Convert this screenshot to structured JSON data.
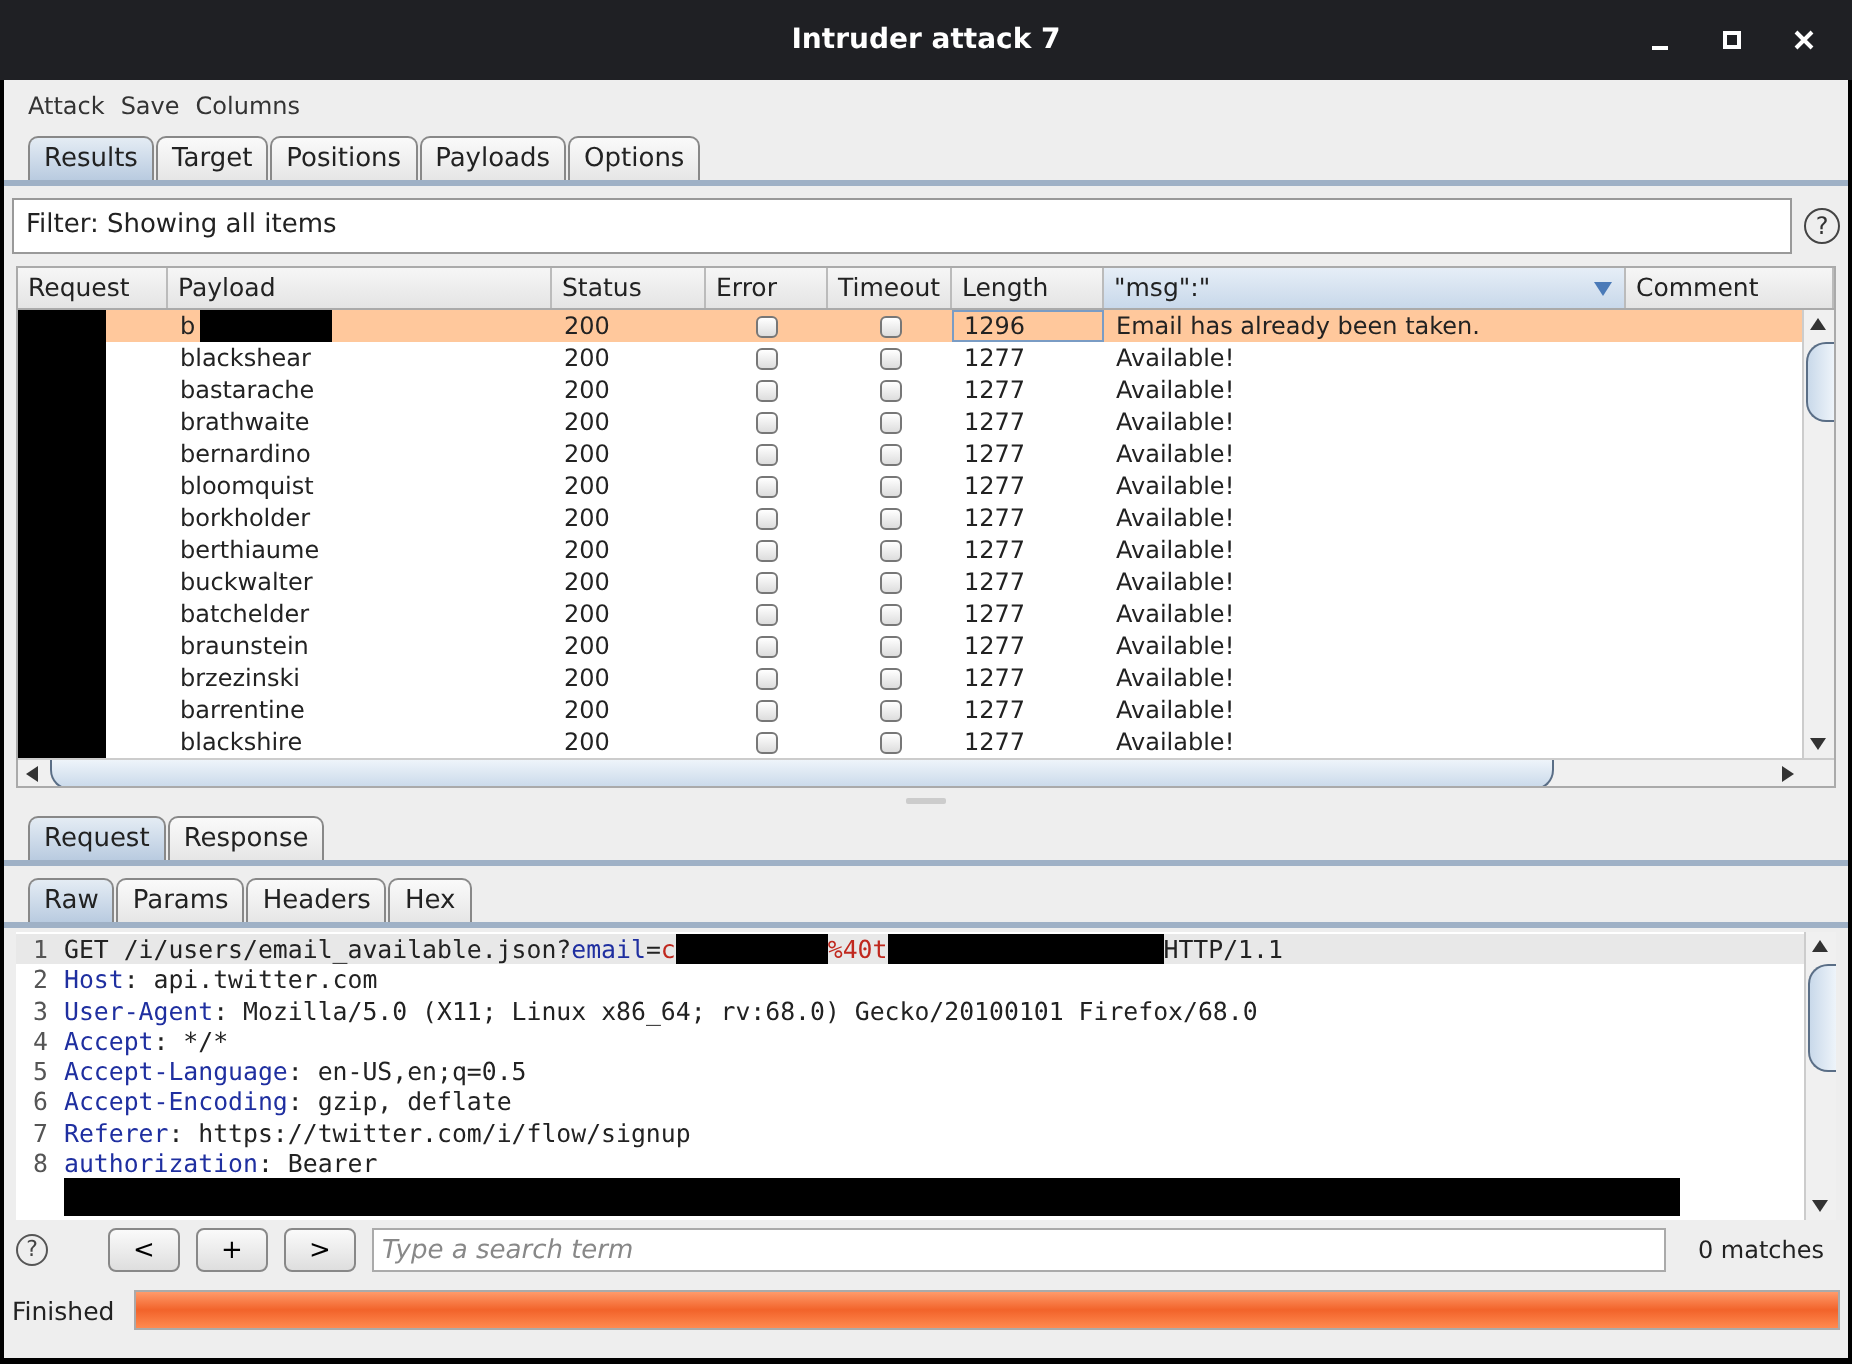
{
  "window": {
    "title": "Intruder attack 7"
  },
  "menu": [
    "Attack",
    "Save",
    "Columns"
  ],
  "tabs": [
    {
      "label": "Results",
      "selected": true
    },
    {
      "label": "Target",
      "selected": false
    },
    {
      "label": "Positions",
      "selected": false
    },
    {
      "label": "Payloads",
      "selected": false
    },
    {
      "label": "Options",
      "selected": false
    }
  ],
  "filter": {
    "text": "Filter: Showing all items",
    "help": "?"
  },
  "results": {
    "columns": [
      {
        "label": "Request",
        "sorted": false
      },
      {
        "label": "Payload",
        "sorted": false
      },
      {
        "label": "Status",
        "sorted": false
      },
      {
        "label": "Error",
        "sorted": false
      },
      {
        "label": "Timeout",
        "sorted": false
      },
      {
        "label": "Length",
        "sorted": false
      },
      {
        "label": "\"msg\":\"",
        "sorted": true
      },
      {
        "label": "Comment",
        "sorted": false
      }
    ],
    "rows": [
      {
        "payload": "b",
        "payload_redacted": true,
        "status": "200",
        "error": false,
        "timeout": false,
        "length": "1296",
        "msg": "Email has already been taken.",
        "selected": true
      },
      {
        "payload": "blackshear",
        "payload_redacted": false,
        "status": "200",
        "error": false,
        "timeout": false,
        "length": "1277",
        "msg": "Available!",
        "selected": false
      },
      {
        "payload": "bastarache",
        "payload_redacted": false,
        "status": "200",
        "error": false,
        "timeout": false,
        "length": "1277",
        "msg": "Available!",
        "selected": false
      },
      {
        "payload": "brathwaite",
        "payload_redacted": false,
        "status": "200",
        "error": false,
        "timeout": false,
        "length": "1277",
        "msg": "Available!",
        "selected": false
      },
      {
        "payload": "bernardino",
        "payload_redacted": false,
        "status": "200",
        "error": false,
        "timeout": false,
        "length": "1277",
        "msg": "Available!",
        "selected": false
      },
      {
        "payload": "bloomquist",
        "payload_redacted": false,
        "status": "200",
        "error": false,
        "timeout": false,
        "length": "1277",
        "msg": "Available!",
        "selected": false
      },
      {
        "payload": "borkholder",
        "payload_redacted": false,
        "status": "200",
        "error": false,
        "timeout": false,
        "length": "1277",
        "msg": "Available!",
        "selected": false
      },
      {
        "payload": "berthiaume",
        "payload_redacted": false,
        "status": "200",
        "error": false,
        "timeout": false,
        "length": "1277",
        "msg": "Available!",
        "selected": false
      },
      {
        "payload": "buckwalter",
        "payload_redacted": false,
        "status": "200",
        "error": false,
        "timeout": false,
        "length": "1277",
        "msg": "Available!",
        "selected": false
      },
      {
        "payload": "batchelder",
        "payload_redacted": false,
        "status": "200",
        "error": false,
        "timeout": false,
        "length": "1277",
        "msg": "Available!",
        "selected": false
      },
      {
        "payload": "braunstein",
        "payload_redacted": false,
        "status": "200",
        "error": false,
        "timeout": false,
        "length": "1277",
        "msg": "Available!",
        "selected": false
      },
      {
        "payload": "brzezinski",
        "payload_redacted": false,
        "status": "200",
        "error": false,
        "timeout": false,
        "length": "1277",
        "msg": "Available!",
        "selected": false
      },
      {
        "payload": "barrentine",
        "payload_redacted": false,
        "status": "200",
        "error": false,
        "timeout": false,
        "length": "1277",
        "msg": "Available!",
        "selected": false
      },
      {
        "payload": "blackshire",
        "payload_redacted": false,
        "status": "200",
        "error": false,
        "timeout": false,
        "length": "1277",
        "msg": "Available!",
        "selected": false
      }
    ]
  },
  "message_tabs": [
    {
      "label": "Request",
      "selected": true
    },
    {
      "label": "Response",
      "selected": false
    }
  ],
  "view_tabs": [
    {
      "label": "Raw",
      "selected": true
    },
    {
      "label": "Params",
      "selected": false
    },
    {
      "label": "Headers",
      "selected": false
    },
    {
      "label": "Hex",
      "selected": false
    }
  ],
  "editor": {
    "lines": [
      {
        "number": "1",
        "highlighted": true,
        "segments": [
          {
            "kind": "text",
            "text": "GET /i/users/email_available.json?"
          },
          {
            "kind": "param",
            "text": "email"
          },
          {
            "kind": "text",
            "text": "="
          },
          {
            "kind": "value",
            "text": "c"
          },
          {
            "kind": "redacted"
          },
          {
            "kind": "value",
            "text": "%40t"
          },
          {
            "kind": "redacted"
          },
          {
            "kind": "text",
            "text": "HTTP/1.1"
          }
        ]
      },
      {
        "number": "2",
        "highlighted": false,
        "segments": [
          {
            "kind": "key",
            "text": "Host"
          },
          {
            "kind": "text",
            "text": ": api.twitter.com"
          }
        ]
      },
      {
        "number": "3",
        "highlighted": false,
        "segments": [
          {
            "kind": "key",
            "text": "User-Agent"
          },
          {
            "kind": "text",
            "text": ": Mozilla/5.0 (X11; Linux x86_64; rv:68.0) Gecko/20100101 Firefox/68.0"
          }
        ]
      },
      {
        "number": "4",
        "highlighted": false,
        "segments": [
          {
            "kind": "key",
            "text": "Accept"
          },
          {
            "kind": "text",
            "text": ": */*"
          }
        ]
      },
      {
        "number": "5",
        "highlighted": false,
        "segments": [
          {
            "kind": "key",
            "text": "Accept-Language"
          },
          {
            "kind": "text",
            "text": ": en-US,en;q=0.5"
          }
        ]
      },
      {
        "number": "6",
        "highlighted": false,
        "segments": [
          {
            "kind": "key",
            "text": "Accept-Encoding"
          },
          {
            "kind": "text",
            "text": ": gzip, deflate"
          }
        ]
      },
      {
        "number": "7",
        "highlighted": false,
        "segments": [
          {
            "kind": "key",
            "text": "Referer"
          },
          {
            "kind": "text",
            "text": ": https://twitter.com/i/flow/signup"
          }
        ]
      },
      {
        "number": "8",
        "highlighted": false,
        "segments": [
          {
            "kind": "key",
            "text": "authorization"
          },
          {
            "kind": "text",
            "text": ": Bearer"
          }
        ]
      },
      {
        "highlighted": false,
        "segments": [
          {
            "kind": "redacted"
          }
        ]
      }
    ]
  },
  "search": {
    "help": "?",
    "buttons": [
      "<",
      "+",
      ">"
    ],
    "placeholder": "Type a search term",
    "matches": "0 matches"
  },
  "status": {
    "text": "Finished",
    "level": 1
  }
}
